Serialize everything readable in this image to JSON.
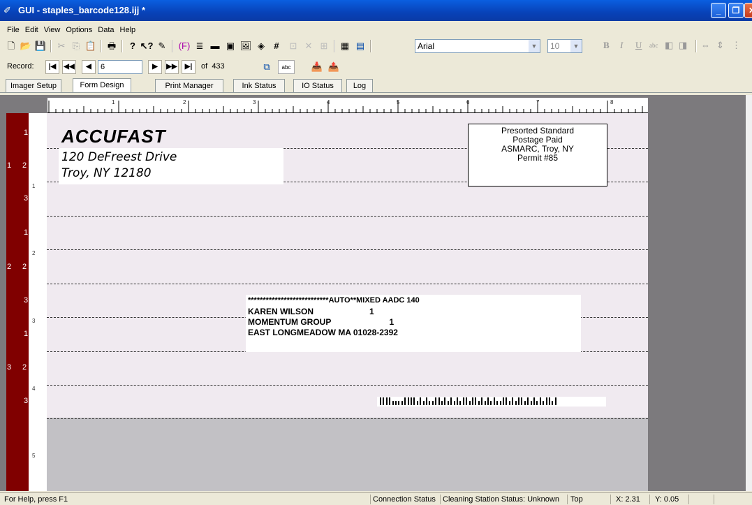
{
  "window": {
    "title": "GUI - staples_barcode128.ijj *"
  },
  "menu": [
    "File",
    "Edit",
    "View",
    "Options",
    "Data",
    "Help"
  ],
  "toolbar": {
    "font_name": "Arial",
    "font_size": "10"
  },
  "record_nav": {
    "label": "Record:",
    "current": "6",
    "of_label": "of",
    "total": "433"
  },
  "tabs": [
    "Imager Setup",
    "Form Design",
    "Print Manager",
    "Ink Status",
    "IO Status",
    "Log"
  ],
  "active_tab": "Form Design",
  "ruler": {
    "h_labels": [
      "1",
      "2",
      "3",
      "4",
      "5",
      "6",
      "7",
      "8"
    ],
    "v_labels": [
      "1",
      "2",
      "3",
      "4",
      "5"
    ],
    "row_labels": [
      "1",
      "2",
      "3",
      "1",
      "2",
      "3",
      "1",
      "2",
      "3"
    ],
    "group_labels": [
      "1",
      "2",
      "3"
    ]
  },
  "form": {
    "logo_text": "ACCUFAST",
    "return_address": [
      "120 DeFreest Drive",
      "Troy, NY 12180"
    ],
    "postage": [
      "Presorted Standard",
      "Postage Paid",
      "ASMARC, Troy, NY",
      "Permit #85"
    ],
    "mail_lines": [
      "***************************AUTO**MIXED AADC 140",
      "KAREN WILSON                        1",
      "MOMENTUM GROUP                         1",
      "EAST LONGMEADOW MA 01028-2392"
    ]
  },
  "statusbar": {
    "help": "For Help, press F1",
    "connection": "Connection Status",
    "cleaning": "Cleaning Station Status: Unknown",
    "position": "Top",
    "x": "X: 2.31",
    "y": "Y: 0.05"
  }
}
